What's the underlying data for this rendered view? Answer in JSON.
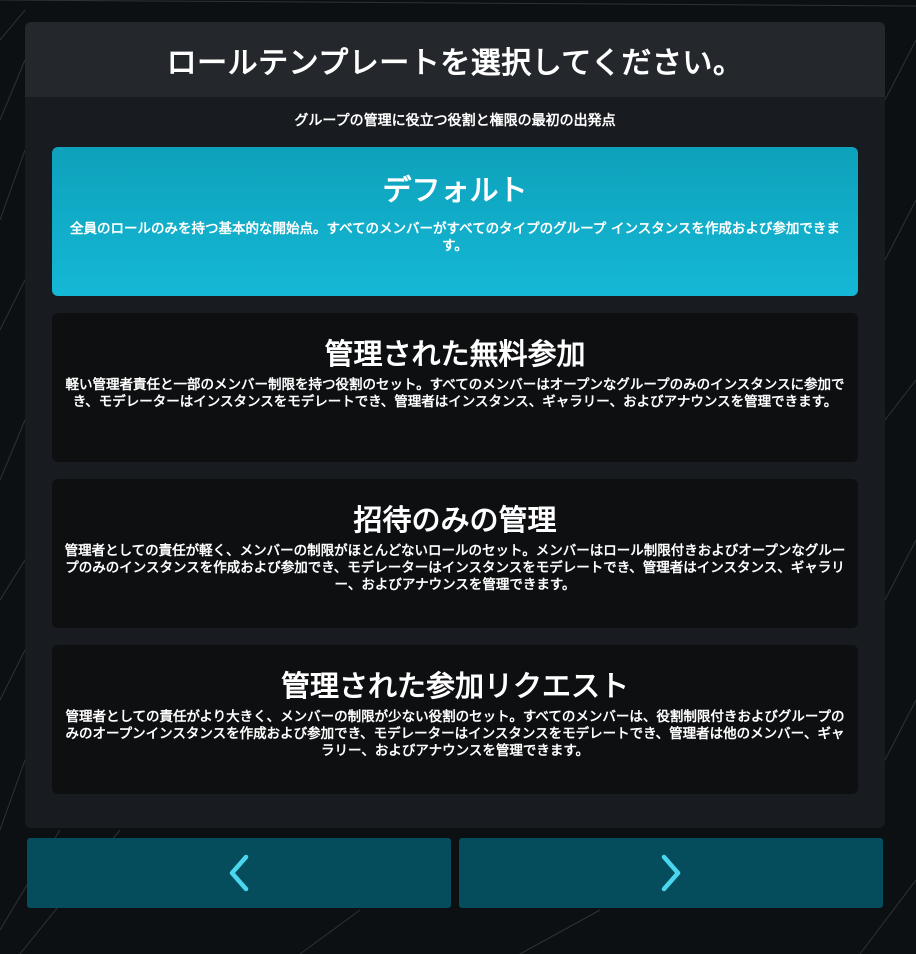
{
  "header": {
    "title": "ロールテンプレートを選択してください。"
  },
  "subtitle": "グループの管理に役立つ役割と権限の最初の出発点",
  "templates": [
    {
      "title": "デフォルト",
      "description": "全員のロールのみを持つ基本的な開始点。すべてのメンバーがすべてのタイプのグループ インスタンスを作成および参加できます。",
      "selected": true
    },
    {
      "title": "管理された無料参加",
      "description": "軽い管理者責任と一部のメンバー制限を持つ役割のセット。すべてのメンバーはオープンなグループのみのインスタンスに参加でき、モデレーターはインスタンスをモデレートでき、管理者はインスタンス、ギャラリー、およびアナウンスを管理できます。",
      "selected": false
    },
    {
      "title": "招待のみの管理",
      "description": "管理者としての責任が軽く、メンバーの制限がほとんどないロールのセット。メンバーはロール制限付きおよびオープンなグループのみのインスタンスを作成および参加でき、モデレーターはインスタンスをモデレートでき、管理者はインスタンス、ギャラリー、およびアナウンスを管理できます。",
      "selected": false
    },
    {
      "title": "管理された参加リクエスト",
      "description": "管理者としての責任がより大きく、メンバーの制限が少ない役割のセット。すべてのメンバーは、役割制限付きおよびグループのみのオープンインスタンスを作成および参加でき、モデレーターはインスタンスをモデレートでき、管理者は他のメンバー、ギャラリー、およびアナウンスを管理できます。",
      "selected": false
    }
  ],
  "nav": {
    "prev_icon": "chevron-left-icon",
    "next_icon": "chevron-right-icon"
  },
  "colors": {
    "accent": "#14b8d6",
    "nav_button": "#054c5c",
    "chevron": "#4ad6ef"
  }
}
